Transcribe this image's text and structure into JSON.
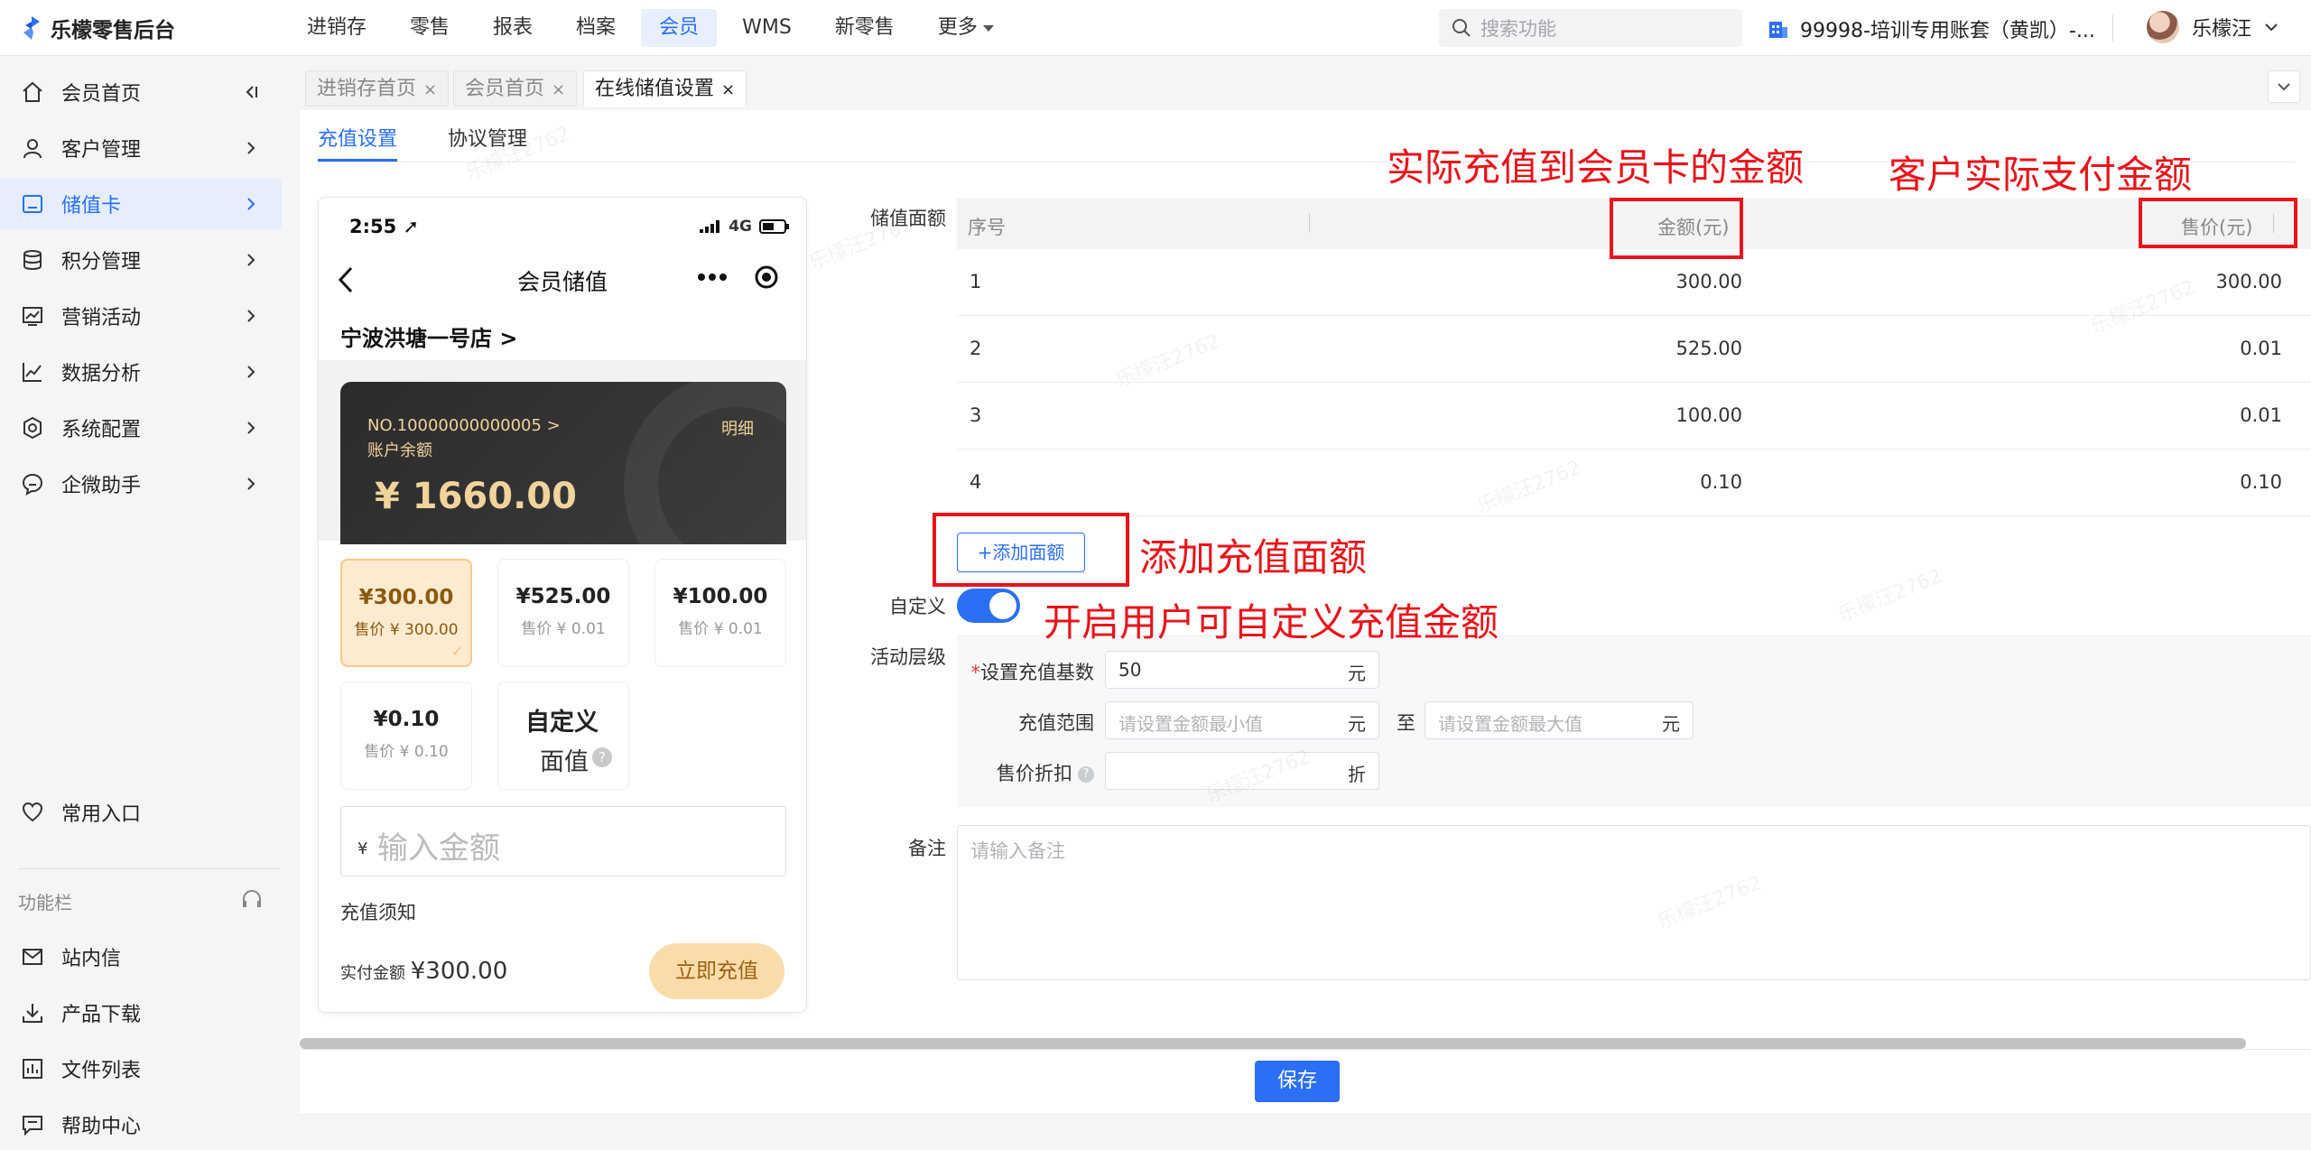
{
  "app": {
    "name": "乐檬零售后台"
  },
  "nav": {
    "items": [
      "进销存",
      "零售",
      "报表",
      "档案",
      "会员",
      "WMS",
      "新零售",
      "更多"
    ],
    "active": "会员"
  },
  "search": {
    "placeholder": "搜索功能"
  },
  "account": {
    "name": "99998-培训专用账套（黄凯）-..."
  },
  "user": {
    "name": "乐檬汪"
  },
  "sidebar": {
    "items": [
      {
        "label": "会员首页",
        "icon": "home-icon"
      },
      {
        "label": "客户管理",
        "icon": "user-icon"
      },
      {
        "label": "储值卡",
        "icon": "card-icon"
      },
      {
        "label": "积分管理",
        "icon": "database-icon"
      },
      {
        "label": "营销活动",
        "icon": "chart-icon"
      },
      {
        "label": "数据分析",
        "icon": "analytics-icon"
      },
      {
        "label": "系统配置",
        "icon": "settings-icon"
      },
      {
        "label": "企微助手",
        "icon": "chat-icon"
      }
    ],
    "common": "常用入口",
    "section_label": "功能栏",
    "bottom_items": [
      {
        "label": "站内信",
        "icon": "mail-icon"
      },
      {
        "label": "产品下载",
        "icon": "download-icon"
      },
      {
        "label": "文件列表",
        "icon": "file-list-icon"
      },
      {
        "label": "帮助中心",
        "icon": "help-icon"
      }
    ]
  },
  "tabs": [
    {
      "label": "进销存首页",
      "close": "×"
    },
    {
      "label": "会员首页",
      "close": "×"
    },
    {
      "label": "在线储值设置",
      "close": "×"
    }
  ],
  "subtabs": [
    "充值设置",
    "协议管理"
  ],
  "phone": {
    "time": "2:55",
    "network": "4G",
    "title": "会员储值",
    "store": "宁波洪塘一号店 >",
    "card_no": "NO.10000000000005 >",
    "balance_label": "账户余额",
    "detail": "明细",
    "balance": "¥ 1660.00",
    "options": [
      {
        "value": "¥300.00",
        "price": "售价 ¥ 300.00"
      },
      {
        "value": "¥525.00",
        "price": "售价 ¥ 0.01"
      },
      {
        "value": "¥100.00",
        "price": "售价 ¥ 0.01"
      },
      {
        "value": "¥0.10",
        "price": "售价 ¥ 0.10"
      }
    ],
    "custom_a": "自定义",
    "custom_b": "面值",
    "custom_q": "?",
    "input_currency": "¥",
    "input_placeholder": "输入金额",
    "notice": "充值须知",
    "pay_label": "实付金额",
    "pay_amount": "¥300.00",
    "pay_button": "立即充值"
  },
  "form": {
    "face_label": "储值面额",
    "headers": {
      "index": "序号",
      "amount": "金额(元)",
      "price": "售价(元)"
    },
    "rows": [
      {
        "index": "1",
        "amount": "300.00",
        "price": "300.00"
      },
      {
        "index": "2",
        "amount": "525.00",
        "price": "0.01"
      },
      {
        "index": "3",
        "amount": "100.00",
        "price": "0.01"
      },
      {
        "index": "4",
        "amount": "0.10",
        "price": "0.10"
      }
    ],
    "add_button": "+添加面额",
    "custom_label": "自定义",
    "custom_enabled": true,
    "tier_label": "活动层级",
    "base_label": "设置充值基数",
    "base_required": "*",
    "base_value": "50",
    "unit_yuan": "元",
    "range_label": "充值范围",
    "range_min_placeholder": "请设置金额最小值",
    "range_to": "至",
    "range_max_placeholder": "请设置金额最大值",
    "discount_label": "售价折扣",
    "discount_help": "?",
    "unit_discount": "折",
    "remark_label": "备注",
    "remark_placeholder": "请输入备注",
    "save": "保存"
  },
  "annotations": {
    "amount": "实际充值到会员卡的金额",
    "price": "客户实际支付金额",
    "add": "添加充值面额",
    "custom": "开启用户可自定义充值金额"
  },
  "watermark": "乐檬汪2762",
  "colors": {
    "primary": "#2a6ff4",
    "annotation": "#e8141b",
    "card_gold": "#f1d39c"
  }
}
